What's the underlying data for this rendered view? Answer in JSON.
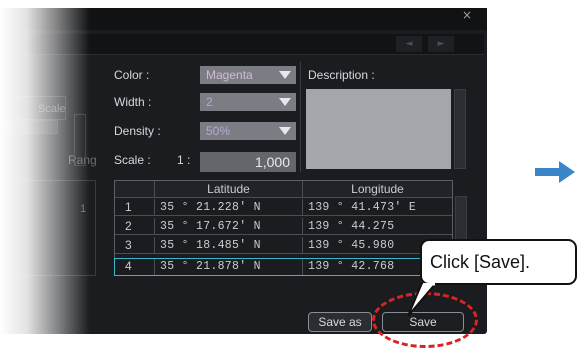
{
  "dialog": {
    "color_label": "Color :",
    "color_value": "Magenta",
    "width_label": "Width :",
    "width_value": "2",
    "density_label": "Density :",
    "density_value": "50%",
    "scale_label": "Scale :",
    "scale_prefix": "1 :",
    "scale_value": "1,000",
    "description_label": "Description :",
    "close_icon": "×"
  },
  "left_ghost": {
    "scale_partial": "Scale",
    "range_partial": "Rang",
    "row_num": "1"
  },
  "table": {
    "headers": [
      "Latitude",
      "Longitude"
    ],
    "rows": [
      {
        "num": "1",
        "lat": "35 ° 21.228' N",
        "lon": "139 ° 41.473' E"
      },
      {
        "num": "2",
        "lat": "35 ° 17.672' N",
        "lon": "139 ° 44.275"
      },
      {
        "num": "3",
        "lat": "35 ° 18.485' N",
        "lon": "139 ° 45.980"
      },
      {
        "num": "4",
        "lat": "35 ° 21.878' N",
        "lon": "139 ° 42.768"
      }
    ]
  },
  "buttons": {
    "save_as": "Save as",
    "save": "Save"
  },
  "callout": {
    "text": "Click [Save]."
  },
  "colors": {
    "accent_arrow": "#3a86c8",
    "highlight_ring": "#d82424",
    "selected_row": "#39b7c9"
  }
}
